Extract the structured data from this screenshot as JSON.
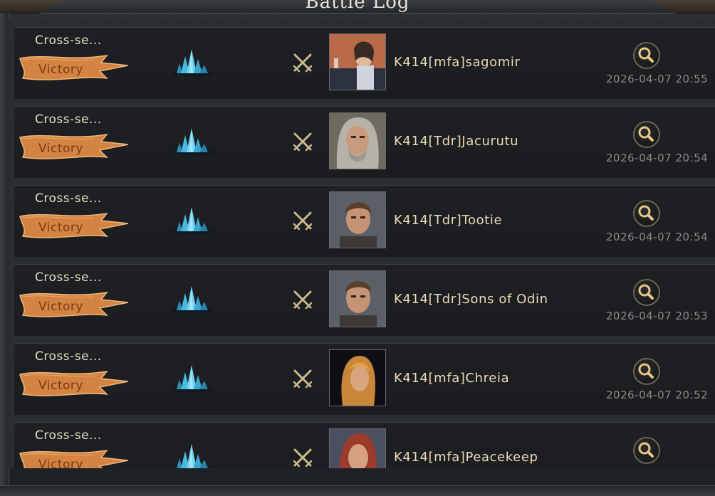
{
  "window": {
    "title": "Battle Log"
  },
  "rows": [
    {
      "mode": "Cross-se...",
      "result": "Victory",
      "player": "K414[mfa]sagomir",
      "time": "2026-04-07 20:55",
      "avatar": "avatar-woman-photo"
    },
    {
      "mode": "Cross-se...",
      "result": "Victory",
      "player": "K414[Tdr]Jacurutu",
      "time": "2026-04-07 20:54",
      "avatar": "avatar-grey-haired-warrior"
    },
    {
      "mode": "Cross-se...",
      "result": "Victory",
      "player": "K414[Tdr]Tootie",
      "time": "2026-04-07 20:54",
      "avatar": "avatar-young-man"
    },
    {
      "mode": "Cross-se...",
      "result": "Victory",
      "player": "K414[Tdr]Sons of Odin",
      "time": "2026-04-07 20:53",
      "avatar": "avatar-young-man"
    },
    {
      "mode": "Cross-se...",
      "result": "Victory",
      "player": "K414[mfa]Chreia",
      "time": "2026-04-07 20:52",
      "avatar": "avatar-blonde-woman"
    },
    {
      "mode": "Cross-se...",
      "result": "Victory",
      "player": "K414[mfa]Peacekeep",
      "time": "",
      "avatar": "avatar-red-haired-woman"
    }
  ],
  "colors": {
    "banner": "#d98a4a",
    "player_text": "#ead9b6",
    "time_text": "#8a8a86"
  },
  "icons": {
    "resource": "crystal-icon",
    "battle": "crossed-swords-icon",
    "detail": "magnifier-icon"
  }
}
